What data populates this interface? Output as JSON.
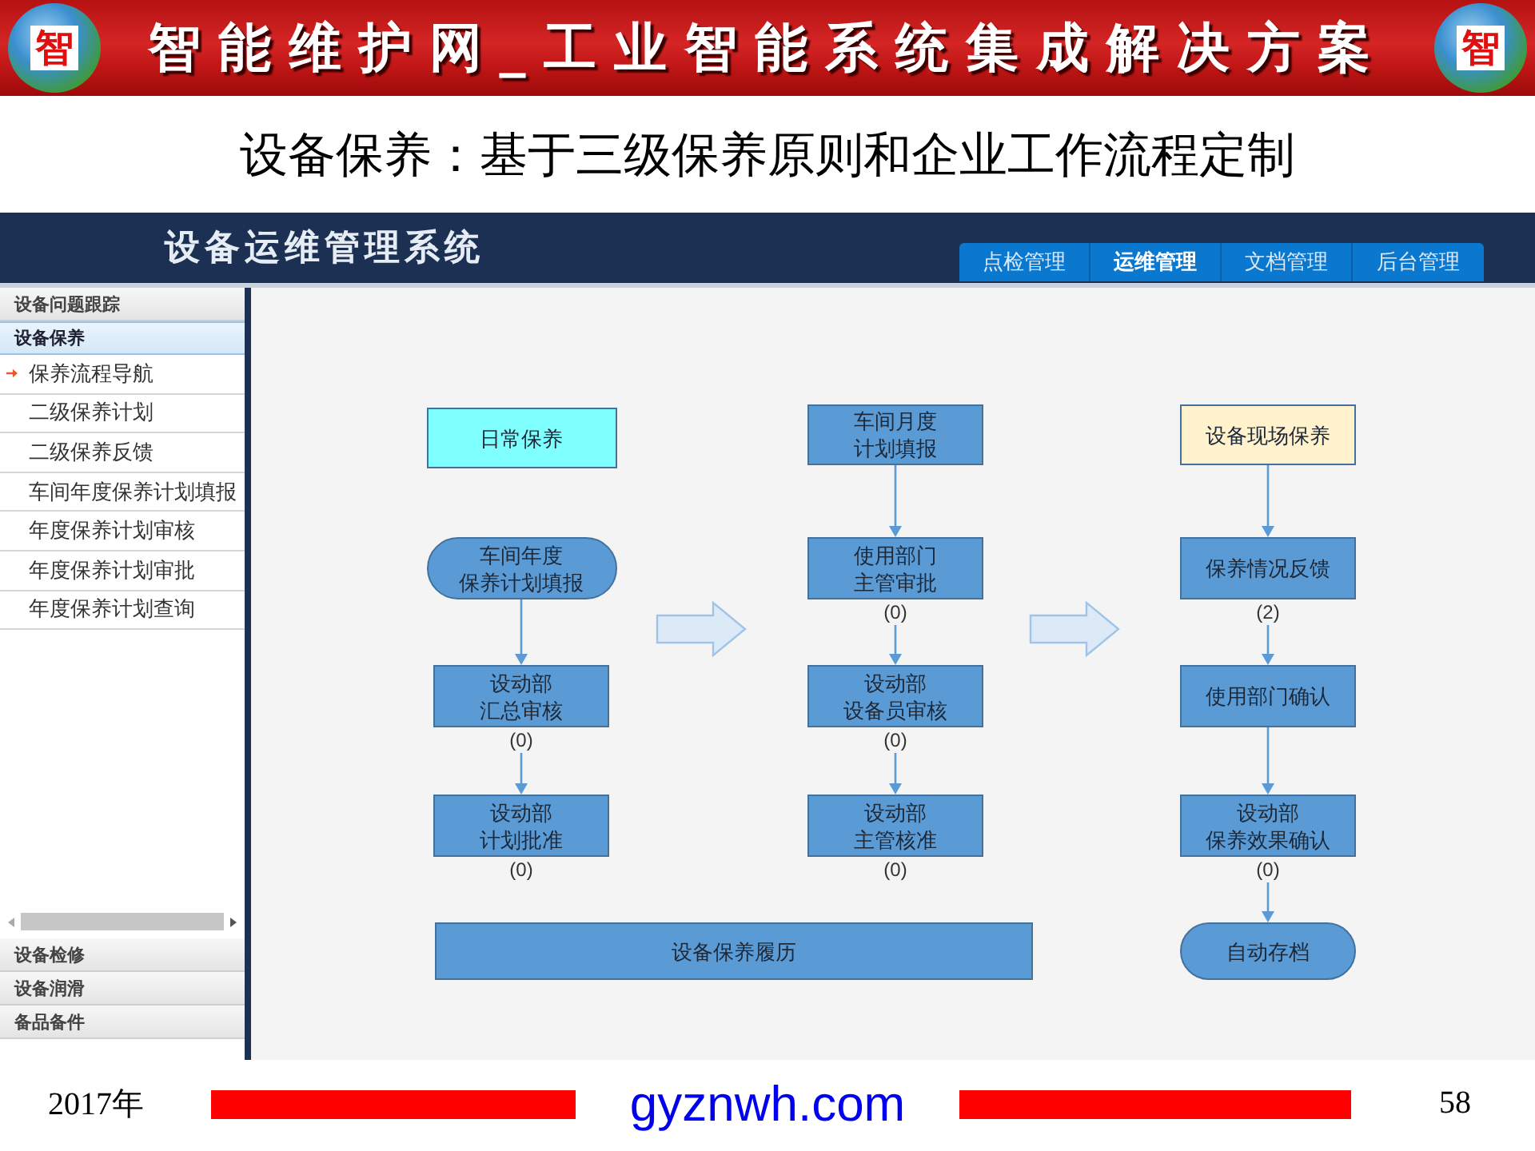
{
  "banner": {
    "title": "智能维护网_工业智能系统集成解决方案",
    "logos": [
      {
        "text": "智"
      },
      {
        "text": "智"
      }
    ]
  },
  "subtitle": "设备保养：基于三级保养原则和企业工作流程定制",
  "app": {
    "title": "设备运维管理系统",
    "nav_tabs": [
      {
        "label": "点检管理",
        "selected": false
      },
      {
        "label": "运维管理",
        "selected": true
      },
      {
        "label": "文档管理",
        "selected": false
      },
      {
        "label": "后台管理",
        "selected": false
      }
    ],
    "sidebar": {
      "groups": [
        {
          "label": "设备问题跟踪",
          "expanded": false
        },
        {
          "label": "设备保养",
          "expanded": true,
          "children": [
            {
              "label": "保养流程导航",
              "selected": true
            },
            {
              "label": "二级保养计划",
              "selected": false
            },
            {
              "label": "二级保养反馈",
              "selected": false
            },
            {
              "label": "车间年度保养计划填报",
              "selected": false
            },
            {
              "label": "年度保养计划审核",
              "selected": false
            },
            {
              "label": "年度保养计划审批",
              "selected": false
            },
            {
              "label": "年度保养计划查询",
              "selected": false
            }
          ]
        },
        {
          "label": "设备检修",
          "expanded": false
        },
        {
          "label": "设备润滑",
          "expanded": false
        },
        {
          "label": "备品备件",
          "expanded": false
        }
      ]
    },
    "flowchart": {
      "columns": [
        {
          "nodes": [
            {
              "kind": "process",
              "lines": [
                "日常保养"
              ],
              "color": "#80ffff"
            },
            {
              "kind": "terminal",
              "lines": [
                "车间年度",
                "保养计划填报"
              ],
              "color": "#5b9bd5",
              "arrow_in": false
            },
            {
              "kind": "process",
              "lines": [
                "设动部",
                "汇总审核"
              ],
              "color": "#5b9bd5",
              "arrow_in": true,
              "count": "(0)"
            },
            {
              "kind": "process",
              "lines": [
                "设动部",
                "计划批准"
              ],
              "color": "#5b9bd5",
              "arrow_in": true,
              "count": "(0)"
            }
          ]
        },
        {
          "nodes": [
            {
              "kind": "process",
              "lines": [
                "车间月度",
                "计划填报"
              ],
              "color": "#5b9bd5"
            },
            {
              "kind": "process",
              "lines": [
                "使用部门",
                "主管审批"
              ],
              "color": "#5b9bd5",
              "arrow_in": true,
              "count": "(0)"
            },
            {
              "kind": "process",
              "lines": [
                "设动部",
                "设备员审核"
              ],
              "color": "#5b9bd5",
              "arrow_in": true,
              "count": "(0)"
            },
            {
              "kind": "process",
              "lines": [
                "设动部",
                "主管核准"
              ],
              "color": "#5b9bd5",
              "arrow_in": true,
              "count": "(0)"
            }
          ]
        },
        {
          "nodes": [
            {
              "kind": "process",
              "lines": [
                "设备现场保养"
              ],
              "color": "#fff2cc"
            },
            {
              "kind": "process",
              "lines": [
                "保养情况反馈"
              ],
              "color": "#5b9bd5",
              "arrow_in": true,
              "count": "(2)"
            },
            {
              "kind": "process",
              "lines": [
                "使用部门确认"
              ],
              "color": "#5b9bd5",
              "arrow_in": true
            },
            {
              "kind": "process",
              "lines": [
                "设动部",
                "保养效果确认"
              ],
              "color": "#5b9bd5",
              "arrow_in": true,
              "count": "(0)"
            },
            {
              "kind": "terminal",
              "lines": [
                "自动存档"
              ],
              "color": "#5b9bd5",
              "arrow_in": true
            }
          ]
        }
      ],
      "history_bar": {
        "label": "设备保养履历",
        "color": "#5b9bd5"
      }
    }
  },
  "footer": {
    "year": "2017年",
    "site": "gyznwh.com",
    "page": "58"
  }
}
